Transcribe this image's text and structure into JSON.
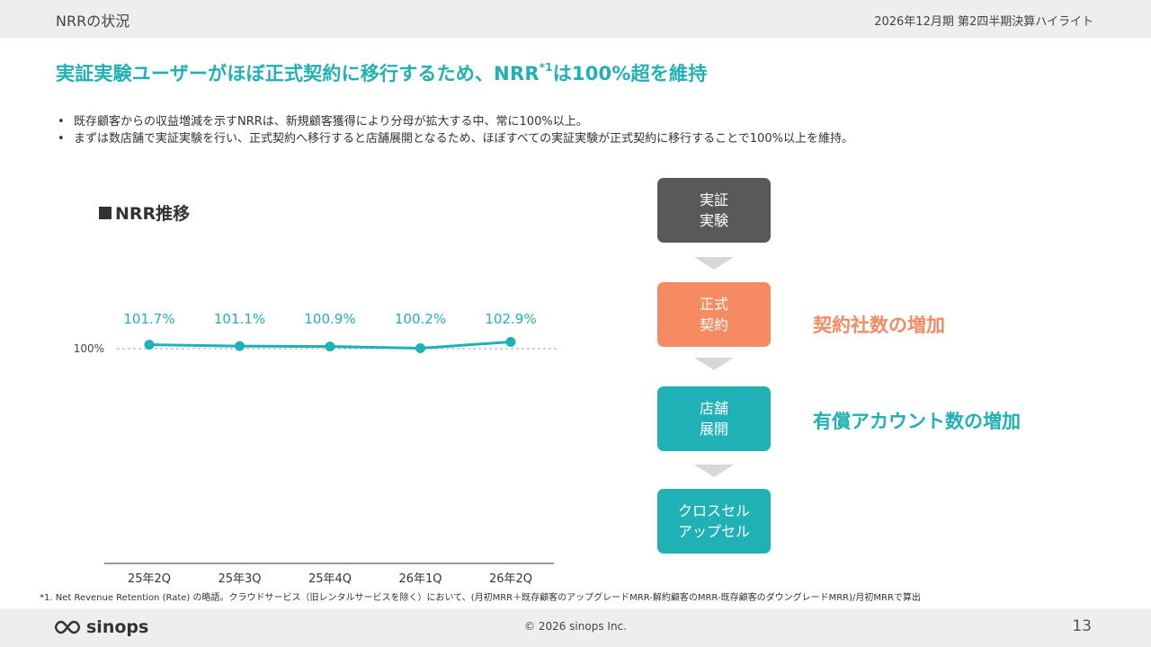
{
  "header": {
    "section": "NRRの状況",
    "period": "2026年12月期 第2四半期決算ハイライト"
  },
  "headline": {
    "before": "実証実験ユーザーがほぼ正式契約に移行するため、NRR",
    "sup": "*1",
    "after": "は100%超を維持"
  },
  "bullets": [
    "既存顧客からの収益増減を示すNRRは、新規顧客獲得により分母が拡大する中、常に100%以上。",
    "まずは数店舗で実証実験を行い、正式契約へ移行すると店舗展開となるため、ほぼすべての実証実験が正式契約に移行することで100%以上を維持。"
  ],
  "chart_title": "NRR推移",
  "chart_data": {
    "type": "line",
    "categories": [
      "25年2Q",
      "25年3Q",
      "25年4Q",
      "26年1Q",
      "26年2Q"
    ],
    "values": [
      101.7,
      101.1,
      100.9,
      100.2,
      102.9
    ],
    "data_labels": [
      "101.7%",
      "101.1%",
      "100.9%",
      "100.2%",
      "102.9%"
    ],
    "reference_line": {
      "value": 100,
      "label": "100%"
    },
    "color": "#1fb1b5",
    "grid": false
  },
  "flow": {
    "steps": [
      {
        "label": "実証\n実験",
        "color": "#595959"
      },
      {
        "label": "正式\n契約",
        "color": "#f68a63"
      },
      {
        "label": "店舗\n展開",
        "color": "#1fb1b5"
      },
      {
        "label": "クロスセル\nアップセル",
        "color": "#1fb1b5"
      }
    ],
    "notes": [
      {
        "text": "契約社数の増加",
        "color": "#f68a63"
      },
      {
        "text": "有償アカウント数の増加",
        "color": "#1fb1b5"
      }
    ]
  },
  "footnote": "*1. Net Revenue Retention (Rate) の略語。クラウドサービス（旧レンタルサービスを除く）において、(月初MRR＋既存顧客のアップグレードMRR-解約顧客のMRR-既存顧客のダウングレードMRR)/月初MRRで算出",
  "footer": {
    "logo_text": "sinops",
    "copyright": "© 2026 sinops Inc.",
    "page": "13"
  }
}
